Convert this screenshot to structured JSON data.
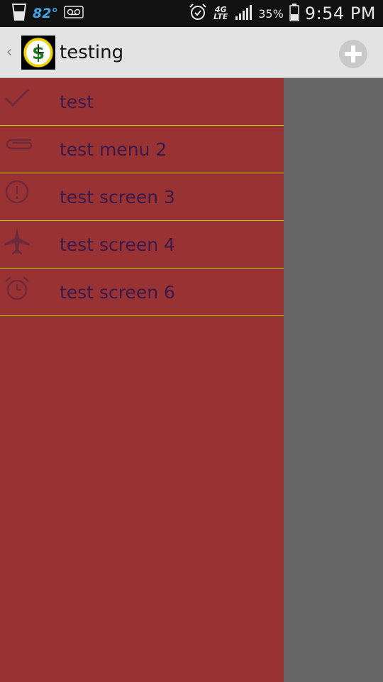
{
  "status_bar": {
    "temperature": "82°",
    "network": "4G LTE",
    "battery_pct": "35%",
    "time": "9:54 PM",
    "icons": [
      "drink-cup-icon",
      "voicemail-icon",
      "alarm-icon",
      "signal-icon",
      "battery-icon"
    ]
  },
  "action_bar": {
    "title": "testing",
    "up_caret": "‹",
    "logo_icon": "dollar-clock-icon",
    "add_icon": "plus-circle-icon"
  },
  "drawer": {
    "background": "#993333",
    "divider_color": "#b5d300",
    "items": [
      {
        "label": "test",
        "icon": "checkmark-icon"
      },
      {
        "label": "test menu 2",
        "icon": "paperclip-icon"
      },
      {
        "label": "test screen 3",
        "icon": "info-icon"
      },
      {
        "label": "test screen 4",
        "icon": "airplane-icon"
      },
      {
        "label": "test screen 6",
        "icon": "alarm-clock-icon"
      }
    ]
  }
}
